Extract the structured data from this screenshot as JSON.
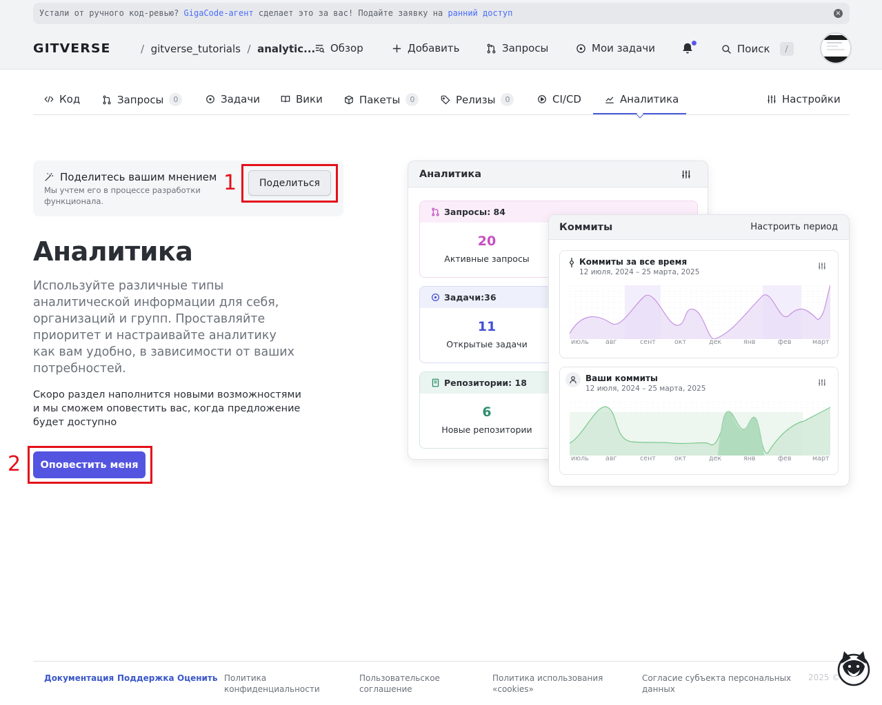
{
  "banner": {
    "text_1": "Устали от ручного код-ревью? ",
    "link_1": "GigaCode-агент",
    "text_2": " сделает это за вас! Подайте заявку на ",
    "link_2": "ранний доступ"
  },
  "header": {
    "logo": "GITVERSE",
    "breadcrumb_owner": "gitverse_tutorials",
    "breadcrumb_repo": "analytic...",
    "nav": {
      "overview": "Обзор",
      "add": "Добавить",
      "requests": "Запросы",
      "my_tasks": "Мои задачи",
      "search": "Поиск",
      "search_key": "/"
    }
  },
  "tabs": [
    {
      "label": "Код"
    },
    {
      "label": "Запросы",
      "count": "0"
    },
    {
      "label": "Задачи"
    },
    {
      "label": "Вики"
    },
    {
      "label": "Пакеты",
      "count": "0"
    },
    {
      "label": "Релизы",
      "count": "0"
    },
    {
      "label": "CI/CD"
    },
    {
      "label": "Аналитика",
      "active": true
    },
    {
      "label": "Настройки"
    }
  ],
  "feedback": {
    "title": "Поделитесь вашим мнением",
    "subtitle": "Мы учтем его в процессе разработки функционала.",
    "button": "Поделиться"
  },
  "markers": {
    "one": "1",
    "two": "2"
  },
  "main": {
    "title": "Аналитика",
    "lead": "Используйте различные типы аналитической информации для себя, организаций и групп. Проставляйте приоритет и настраивайте аналитику как вам удобно, в зависимости от ваших потребностей.",
    "note": "Скоро раздел наполнится новыми возможностями и мы сможем оповестить вас, когда предложение будет доступно",
    "button": "Оповестить меня"
  },
  "preview": {
    "analytics_title": "Аналитика",
    "stats": [
      {
        "head": "Запросы: 84",
        "number": "20",
        "label": "Активные запросы",
        "color": "#c64fc0",
        "bg": "#fbeefa"
      },
      {
        "head": "Задачи:36",
        "number": "11",
        "label": "Открытые задачи",
        "color": "#4450d6",
        "bg": "#eef0fb"
      },
      {
        "head": "Репозитории: 18",
        "number": "6",
        "label": "Новые репозитории",
        "color": "#2f8f6e",
        "bg": "#eaf4f0"
      }
    ],
    "commits_title": "Коммиты",
    "commits_link": "Настроить период",
    "charts": [
      {
        "title": "Коммиты за все время",
        "date": "12 июля, 2024 – 25 марта, 2025",
        "color": "#c792e0"
      },
      {
        "title": "Ваши коммиты",
        "date": "12 июля, 2024 – 25 марта, 2025",
        "color": "#7cc98e"
      }
    ],
    "months": [
      "июль",
      "авг",
      "сент",
      "окт",
      "дек",
      "янв",
      "фев",
      "март"
    ]
  },
  "footer": {
    "links_primary": [
      "Документация",
      "Поддержка",
      "Оценить"
    ],
    "privacy": "Политика\nконфиденциальности",
    "agreement": "Пользовательское\nсоглашение",
    "cookies": "Политика использования\n«cookies»",
    "consent": "Согласие субъекта персональных\nданных",
    "copyright": "2025 ©"
  }
}
